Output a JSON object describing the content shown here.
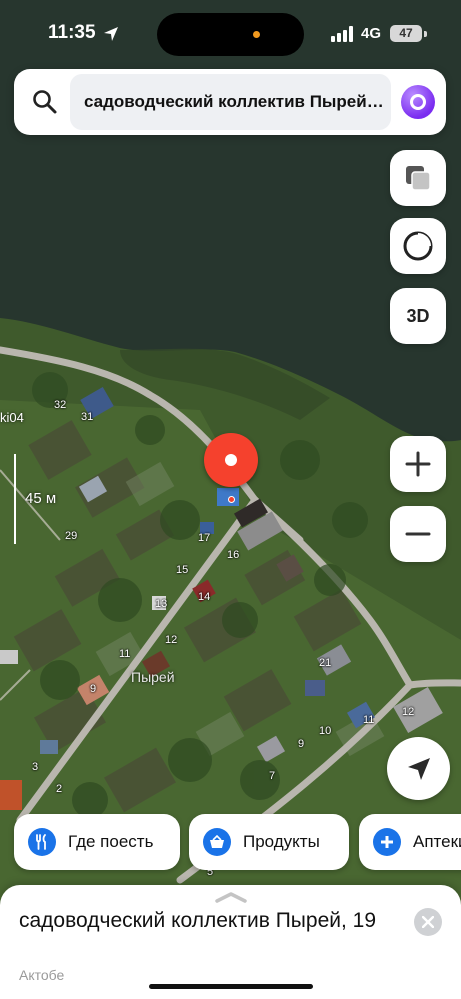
{
  "status_bar": {
    "time": "11:35",
    "network": "4G",
    "battery": "47"
  },
  "search": {
    "query": "садоводческий коллектив Пырей, 19"
  },
  "map_controls": {
    "three_d_label": "3D"
  },
  "map": {
    "scale_label": "45 м",
    "place_label": "Пырей",
    "edge_label": "ki04",
    "house_numbers": [
      "32",
      "31",
      "29",
      "17",
      "16",
      "15",
      "14",
      "13",
      "12",
      "11",
      "9",
      "21",
      "10",
      "11",
      "12",
      "9",
      "7",
      "3",
      "2",
      "5"
    ]
  },
  "categories": [
    {
      "label": "Где поесть",
      "icon": "fork-knife-icon",
      "color": "#1a73e8"
    },
    {
      "label": "Продукты",
      "icon": "basket-icon",
      "color": "#1a73e8"
    },
    {
      "label": "Аптеки",
      "icon": "plus-icon",
      "color": "#1a73e8"
    }
  ],
  "sheet": {
    "title": "садоводческий коллектив Пырей, 19",
    "subtitle": "Актобе"
  },
  "colors": {
    "pin": "#f5412d",
    "accent": "#1a73e8",
    "water": "#26362d"
  }
}
